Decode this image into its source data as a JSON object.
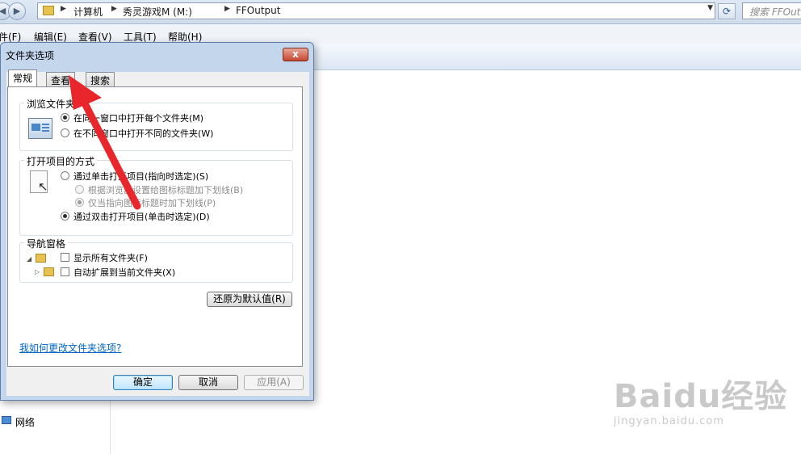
{
  "explorer": {
    "breadcrumbs": [
      "计算机",
      "秀灵游戏M (M:)",
      "FFOutput"
    ],
    "search_placeholder": "搜索 FFOut",
    "menu": [
      "件(F)",
      "编辑(E)",
      "查看(V)",
      "工具(T)",
      "帮助(H)"
    ],
    "nav_item": "网络"
  },
  "dialog": {
    "title": "文件夹选项",
    "close_label": "x",
    "tabs": [
      "常规",
      "查看",
      "搜索"
    ],
    "active_tab": "常规",
    "browse_group": {
      "title": "浏览文件夹",
      "options": [
        {
          "label": "在同一窗口中打开每个文件夹(M)",
          "selected": true
        },
        {
          "label": "在不同窗口中打开不同的文件夹(W)",
          "selected": false
        }
      ]
    },
    "open_group": {
      "title": "打开项目的方式",
      "options": [
        {
          "label": "通过单击打开项目(指向时选定)(S)",
          "selected": false,
          "disabled": false
        },
        {
          "label": "根据浏览器设置给图标标题加下划线(B)",
          "selected": false,
          "disabled": true
        },
        {
          "label": "仅当指向图标标题时加下划线(P)",
          "selected": true,
          "disabled": true
        },
        {
          "label": "通过双击打开项目(单击时选定)(D)",
          "selected": true,
          "disabled": false
        }
      ]
    },
    "nav_group": {
      "title": "导航窗格",
      "checkboxes": [
        {
          "label": "显示所有文件夹(F)",
          "checked": false
        },
        {
          "label": "自动扩展到当前文件夹(X)",
          "checked": false
        }
      ]
    },
    "restore_defaults": "还原为默认值(R)",
    "help_link": "我如何更改文件夹选项?",
    "buttons": {
      "ok": "确定",
      "cancel": "取消",
      "apply": "应用(A)"
    }
  },
  "watermark": {
    "logo": "Baidu经验",
    "url": "jingyan.baidu.com"
  },
  "colors": {
    "arrow": "#e8262b",
    "link": "#0066cc",
    "titlebar": "#c4d6ec"
  }
}
